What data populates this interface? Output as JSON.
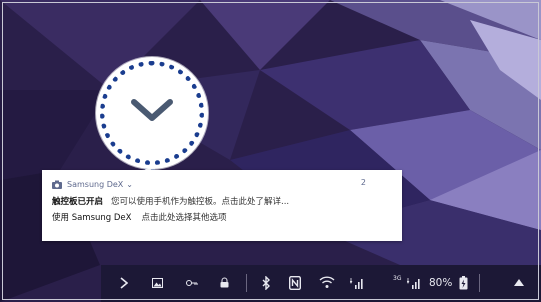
{
  "notification": {
    "app_name": "Samsung DeX",
    "expand_glyph": "⌄",
    "count": "2",
    "line1_title": "触控板已开启",
    "line1_body": "您可以使用手机作为触控板。点击此处了解详...",
    "line2_title": "使用 Samsung DeX",
    "line2_body": "点击此处选择其他选项"
  },
  "taskbar": {
    "network_3g": "3G",
    "battery_percent": "80%"
  },
  "icons": [
    "camera-icon",
    "chevron-down-icon",
    "chevron-right-icon",
    "gallery-icon",
    "key-icon",
    "lock-app-icon",
    "bluetooth-icon",
    "nfc-icon",
    "wifi-icon",
    "signal-icon",
    "battery-icon",
    "arrow-up-icon"
  ],
  "colors": {
    "callout_ring": "#1a3d8f",
    "taskbar_bg": "#1c1836",
    "wallpaper_base": "#2a1f4a",
    "notif_meta": "#5f6a8e"
  }
}
